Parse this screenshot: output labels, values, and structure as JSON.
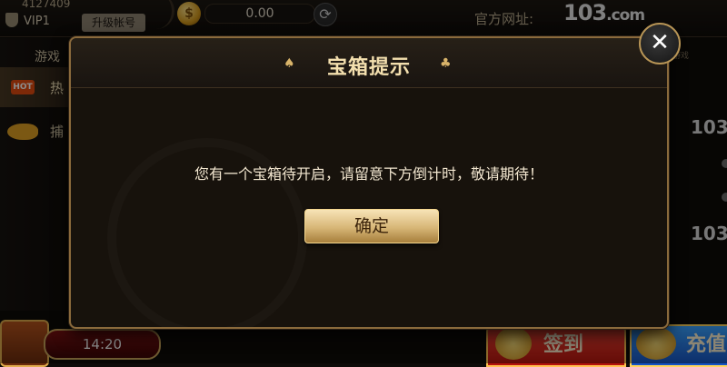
{
  "topbar": {
    "user_id": "4127409",
    "vip_label": "VIP1",
    "upgrade_label": "升级帐号",
    "coin_symbol": "$",
    "coin_balance": "0.00",
    "site_label": "官方网址:",
    "site_logo_main": "103",
    "site_logo_suffix": ".com"
  },
  "sidebar": {
    "header": "游戏",
    "hot_badge": "HOT",
    "hot_label": "热",
    "fish_label": "捕"
  },
  "right_panel": {
    "tab_text": "游戏",
    "logo_1": "103",
    "logo_2": "103"
  },
  "bottom": {
    "timer": "14:20",
    "checkin_label": "签到",
    "recharge_label": "充值"
  },
  "dialog": {
    "title": "宝箱提示",
    "message": "您有一个宝箱待开启，请留意下方倒计时，敬请期待！",
    "confirm_label": "确定",
    "close_symbol": "✕",
    "spade_symbol": "♠",
    "club_symbol": "♣"
  }
}
